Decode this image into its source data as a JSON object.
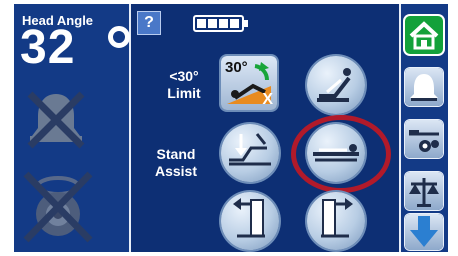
{
  "head_angle": {
    "title": "Head Angle",
    "value": "32"
  },
  "main": {
    "help_label": "?",
    "battery_bars": 4,
    "limit_label_line1": "<30°",
    "limit_label_line2": "Limit",
    "limit_badge": "30°",
    "stand_assist_line1": "Stand",
    "stand_assist_line2": "Assist",
    "limit_x": "X"
  },
  "colors": {
    "screen_bg": "#0d2b6b",
    "highlight_ring": "#b11a2a",
    "home_green": "#13a13a"
  },
  "icons": [
    "bell-off-icon",
    "camera-off-icon",
    "battery-icon",
    "help-icon",
    "limit-30-icon",
    "recline-chair-icon",
    "stand-assist-icon",
    "flat-bed-icon",
    "exit-left-icon",
    "exit-right-icon",
    "home-icon",
    "alarm-bell-icon",
    "bed-settings-icon",
    "scale-icon",
    "scroll-down-icon"
  ]
}
